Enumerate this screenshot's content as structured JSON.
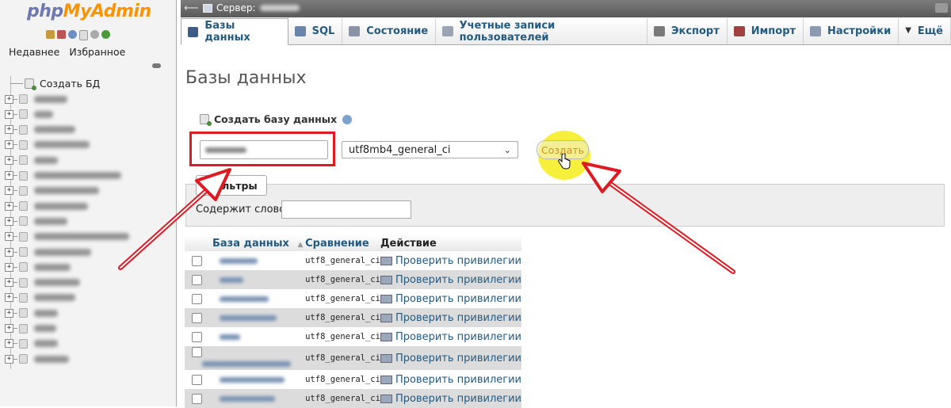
{
  "nav": {
    "logo_php": "php",
    "logo_myadmin": "MyAdmin",
    "tab_recent": "Недавнее",
    "tab_favorites": "Избранное",
    "create_db_label": "Создать БД",
    "db_items": [
      {
        "w": 42
      },
      {
        "w": 24
      },
      {
        "w": 52
      },
      {
        "w": 70
      },
      {
        "w": 30
      },
      {
        "w": 110
      },
      {
        "w": 82
      },
      {
        "w": 68
      },
      {
        "w": 42
      },
      {
        "w": 120
      },
      {
        "w": 72
      },
      {
        "w": 46
      },
      {
        "w": 58
      },
      {
        "w": 52
      },
      {
        "w": 30
      },
      {
        "w": 28
      },
      {
        "w": 30
      },
      {
        "w": 44
      }
    ]
  },
  "topbar": {
    "server_label": "Сервер:"
  },
  "tabs": [
    {
      "label": "Базы данных",
      "icon": "database-icon",
      "active": true
    },
    {
      "label": "SQL",
      "icon": "sql-icon"
    },
    {
      "label": "Состояние",
      "icon": "status-icon"
    },
    {
      "label": "Учетные записи пользователей",
      "icon": "users-icon"
    },
    {
      "label": "Экспорт",
      "icon": "export-icon"
    },
    {
      "label": "Импорт",
      "icon": "import-icon"
    },
    {
      "label": "Настройки",
      "icon": "wrench-icon"
    },
    {
      "label": "Ещё",
      "icon": "chevron-down-icon"
    }
  ],
  "main": {
    "page_title": "Базы данных",
    "create_db_title": "Создать базу данных",
    "collation_value": "utf8mb4_general_ci",
    "create_button": "Создать",
    "filters_title": "Фильтры",
    "filter_label": "Содержит слово:"
  },
  "table": {
    "col_name": "База данных",
    "col_collation": "Сравнение",
    "col_action": "Действие",
    "rows": [
      {
        "collation": "utf8_general_ci",
        "action": "Проверить привилегии",
        "w": 48
      },
      {
        "collation": "utf8_general_ci",
        "action": "Проверить привилегии",
        "w": 30
      },
      {
        "collation": "utf8_general_ci",
        "action": "Проверить привилегии",
        "w": 62
      },
      {
        "collation": "utf8_general_ci",
        "action": "Проверить привилегии",
        "w": 72
      },
      {
        "collation": "utf8_general_ci",
        "action": "Проверить привилегии",
        "w": 26
      },
      {
        "collation": "utf8_general_ci",
        "action": "Проверить привилегии",
        "w": 112
      },
      {
        "collation": "utf8_general_ci",
        "action": "Проверить привилегии",
        "w": 82
      },
      {
        "collation": "utf8_general_ci",
        "action": "Проверить привилегии",
        "w": 70
      }
    ]
  },
  "colors": {
    "accent_link": "#235a81",
    "annotation_red": "#e01a22",
    "highlight_yellow": "#f5ee28"
  }
}
